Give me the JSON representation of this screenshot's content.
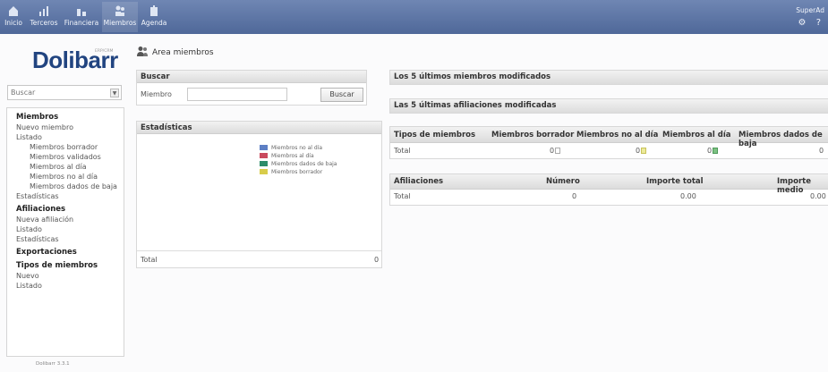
{
  "topbar": {
    "items": [
      {
        "label": "Inicio",
        "icon": "home-icon"
      },
      {
        "label": "Terceros",
        "icon": "chart-icon"
      },
      {
        "label": "Financiera",
        "icon": "money-icon"
      },
      {
        "label": "Miembros",
        "icon": "members-icon"
      },
      {
        "label": "Agenda",
        "icon": "agenda-icon"
      }
    ],
    "user": "SuperAd",
    "user_icons": "⚙ ?"
  },
  "sidebar": {
    "logo": "Dolibarr",
    "logo_sub": "ERP/CRM",
    "search_placeholder": "Buscar",
    "menu": {
      "miembros": "Miembros",
      "nuevo_miembro": "Nuevo miembro",
      "listado": "Listado",
      "borrador": "Miembros borrador",
      "validados": "Miembros validados",
      "al_dia": "Miembros al día",
      "no_al_dia": "Miembros no al día",
      "baja": "Miembros dados de baja",
      "estadisticas": "Estadísticas",
      "afiliaciones": "Afiliaciones",
      "nueva_afiliacion": "Nueva afiliación",
      "listado2": "Listado",
      "estadisticas2": "Estadísticas",
      "exportaciones": "Exportaciones",
      "tipos": "Tipos de miembros",
      "nuevo": "Nuevo",
      "listado3": "Listado"
    },
    "version": "Dolibarr 3.3.1"
  },
  "main": {
    "title": "Area miembros",
    "buscar": {
      "header": "Buscar",
      "label": "Miembro",
      "button": "Buscar"
    },
    "estadisticas": {
      "header": "Estadísticas",
      "legend": [
        {
          "label": "Miembros no al día",
          "color": "#5d7fc4"
        },
        {
          "label": "Miembros al día",
          "color": "#c94a5e"
        },
        {
          "label": "Miembros dados de baja",
          "color": "#2d8c6a"
        },
        {
          "label": "Miembros borrador",
          "color": "#d8cc4a"
        }
      ],
      "total_label": "Total",
      "total_value": "0"
    },
    "ultimos_miembros": "Los 5 últimos miembros modificados",
    "ultimas_afiliaciones": "Las 5 últimas afiliaciones modificadas",
    "tipos_table": {
      "headers": [
        "Tipos de miembros",
        "Miembros borrador",
        "Miembros no al día",
        "Miembros al día",
        "Miembros dados de baja"
      ],
      "total_label": "Total",
      "values": [
        "0",
        "0",
        "0",
        "0"
      ]
    },
    "afiliaciones_table": {
      "headers": [
        "Afiliaciones",
        "Número",
        "Importe total",
        "Importe medio"
      ],
      "total_label": "Total",
      "values": [
        "0",
        "0.00",
        "0.00"
      ]
    }
  }
}
